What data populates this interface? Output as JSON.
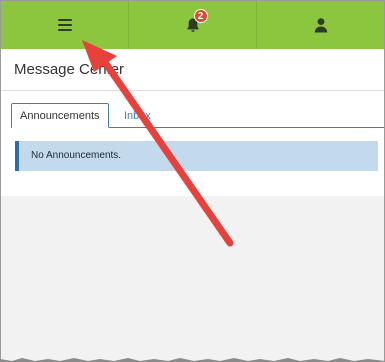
{
  "topbar": {
    "menu_icon": "hamburger-menu-icon",
    "notifications_icon": "bell-icon",
    "notifications_count": "2",
    "user_icon": "user-icon"
  },
  "page": {
    "title": "Message Center"
  },
  "tabs": [
    {
      "label": "Announcements",
      "active": true
    },
    {
      "label": "Inbox",
      "active": false
    }
  ],
  "alert": {
    "text": "No Announcements."
  },
  "colors": {
    "topbar": "#8cc63f",
    "tab_accent": "#3e7fb5",
    "alert_bg": "#c3d9ec",
    "badge": "#e2472f",
    "annotation_arrow": "#e8403a"
  }
}
